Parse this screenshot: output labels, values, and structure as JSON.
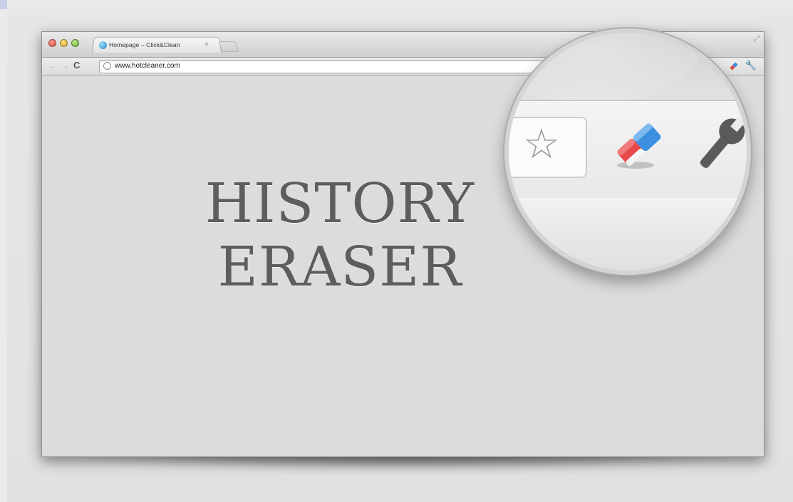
{
  "browser": {
    "tab": {
      "title": "Homepage – Click&Clean",
      "close_glyph": "×",
      "favicon_icon": "click-and-clean-favicon-icon"
    },
    "toolbar": {
      "back_glyph": "←",
      "forward_glyph": "→",
      "reload_glyph": "C",
      "url": "www.hotcleaner.com",
      "extension_icons": [
        "star-icon",
        "eraser-icon",
        "wrench-icon"
      ]
    }
  },
  "page": {
    "headline_line1": "HISTORY",
    "headline_line2": "ERASER"
  },
  "magnifier": {
    "icons": [
      "bookmark-star-icon",
      "eraser-icon",
      "wrench-icon"
    ],
    "star_glyph": "☆"
  },
  "colors": {
    "eraser_red": "#e64a4a",
    "eraser_blue": "#3d8fe0",
    "headline": "#5d5d5d"
  }
}
